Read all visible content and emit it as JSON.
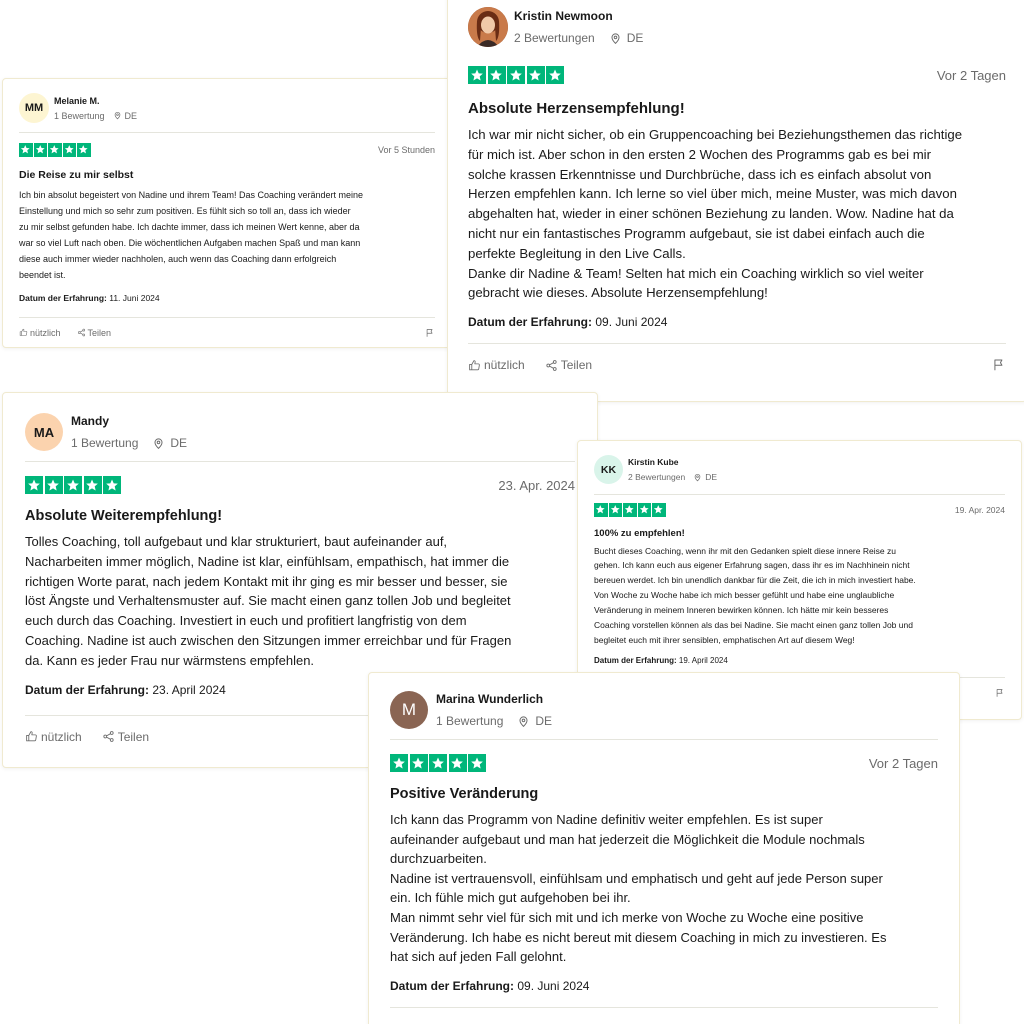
{
  "colors": {
    "star_green": "#00b67a",
    "avatar_mm": "#fdf5d2",
    "avatar_ma": "#fbd3ae",
    "avatar_kk": "#d9f4ea",
    "avatar_m": "#8a6553",
    "avatar_kn": "#7a3a1e"
  },
  "labels": {
    "helpful": "nützlich",
    "share": "Teilen",
    "experience_prefix": "Datum der Erfahrung:"
  },
  "reviews": [
    {
      "initials": "MM",
      "name": "Melanie M.",
      "reviews_count": "1 Bewertung",
      "country": "DE",
      "rating": 5,
      "date": "Vor 5 Stunden",
      "title": "Die Reise zu mir selbst",
      "body": "Ich bin absolut begeistert von Nadine und ihrem Team! Das Coaching verändert meine\nEinstellung und mich so sehr zum positiven. Es fühlt sich so toll an, dass ich wieder\nzu mir selbst gefunden habe. Ich dachte immer, dass ich meinen Wert kenne, aber da\nwar so viel Luft nach oben. Die wöchentlichen Aufgaben machen Spaß und man kann\ndiese auch immer wieder nachholen, auch wenn das Coaching dann erfolgreich\nbeendet ist.",
      "experience_date": "11. Juni 2024"
    },
    {
      "initials": "",
      "name": "Kristin Newmoon",
      "reviews_count": "2 Bewertungen",
      "country": "DE",
      "rating": 5,
      "date": "Vor 2 Tagen",
      "title": "Absolute Herzensempfehlung!",
      "body": "Ich war mir nicht sicher, ob ein Gruppencoaching bei Beziehungsthemen das richtige\nfür mich ist. Aber schon in den ersten 2 Wochen des Programms gab es bei mir\nsolche krassen Erkenntnisse und Durchbrüche, dass ich es einfach absolut von\nHerzen empfehlen kann. Ich lerne so viel über mich, meine Muster, was mich davon\nabgehalten hat, wieder in einer schönen Beziehung zu landen. Wow. Nadine hat da\nnicht nur ein fantastisches Programm aufgebaut, sie ist dabei einfach auch die\nperfekte Begleitung in den Live Calls.\nDanke dir Nadine & Team! Selten hat mich ein Coaching wirklich so viel weiter\ngebracht wie dieses. Absolute Herzensempfehlung!",
      "experience_date": "09. Juni 2024"
    },
    {
      "initials": "MA",
      "name": "Mandy",
      "reviews_count": "1 Bewertung",
      "country": "DE",
      "rating": 5,
      "date": "23. Apr. 2024",
      "title": "Absolute Weiterempfehlung!",
      "body": "Tolles Coaching, toll aufgebaut und klar strukturiert, baut aufeinander auf,\nNacharbeiten immer möglich, Nadine ist klar, einfühlsam, empathisch, hat immer die\nrichtigen Worte parat, nach jedem Kontakt mit ihr ging es mir besser und besser, sie\nlöst Ängste und Verhaltensmuster auf. Sie macht einen ganz tollen Job und begleitet\neuch durch das Coaching. Investiert in euch und profitiert langfristig von dem\nCoaching. Nadine ist auch zwischen den Sitzungen immer erreichbar und für Fragen\nda. Kann es jeder Frau nur wärmstens empfehlen.",
      "experience_date": "23. April 2024"
    },
    {
      "initials": "KK",
      "name": "Kirstin Kube",
      "reviews_count": "2 Bewertungen",
      "country": "DE",
      "rating": 5,
      "date": "19. Apr. 2024",
      "title": "100% zu empfehlen!",
      "body": "Bucht dieses Coaching, wenn ihr mit den Gedanken spielt diese innere Reise zu\ngehen. Ich kann euch aus eigener Erfahrung sagen, dass ihr es im Nachhinein nicht\nbereuen werdet. Ich bin unendlich dankbar für die Zeit, die ich in mich investiert habe.\nVon Woche zu Woche habe ich mich besser gefühlt und habe eine unglaubliche\nVeränderung in meinem Inneren bewirken können. Ich hätte mir kein besseres\nCoaching vorstellen können als das bei Nadine. Sie macht einen ganz tollen Job und\nbegleitet euch mit ihrer sensiblen, emphatischen Art auf diesem Weg!",
      "experience_date": "19. April 2024"
    },
    {
      "initials": "M",
      "name": "Marina Wunderlich",
      "reviews_count": "1 Bewertung",
      "country": "DE",
      "rating": 5,
      "date": "Vor 2 Tagen",
      "title": "Positive Veränderung",
      "body": "Ich kann das Programm von Nadine definitiv weiter empfehlen. Es ist super\naufeinander aufgebaut und man hat jederzeit die Möglichkeit die Module nochmals\ndurchzuarbeiten.\nNadine ist vertrauensvoll, einfühlsam und emphatisch und geht auf jede Person super\nein. Ich fühle mich gut aufgehoben bei ihr.\nMan nimmt sehr viel für sich mit und ich merke von Woche zu Woche eine positive\nVeränderung. Ich habe es nicht bereut mit diesem Coaching in mich zu investieren. Es\nhat sich auf jeden Fall gelohnt.",
      "experience_date": "09. Juni 2024"
    }
  ]
}
